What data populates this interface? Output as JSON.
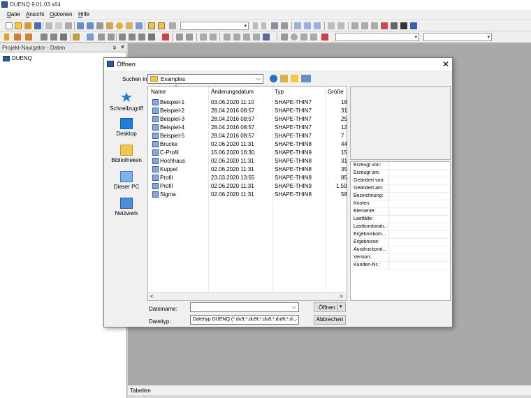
{
  "app": {
    "title": "DUENQ 9.01.03 x64"
  },
  "menu": {
    "items": [
      {
        "accel": "D",
        "rest": "atei"
      },
      {
        "accel": "A",
        "rest": "nsicht"
      },
      {
        "accel": "O",
        "rest": "ptionen"
      },
      {
        "accel": "H",
        "rest": "ilfe"
      }
    ]
  },
  "navigator": {
    "title": "Projekt-Navigator - Daten",
    "pin": "ș",
    "close": "✕",
    "root": "DUENQ"
  },
  "tables_panel": {
    "title": "Tabellen"
  },
  "dialog": {
    "title": "Öffnen",
    "close": "✕",
    "look_in_label": "Suchen in:",
    "look_in_value": "Examples",
    "places": [
      "Schnellzugriff",
      "Desktop",
      "Bibliotheken",
      "Dieser PC",
      "Netzwerk"
    ],
    "columns": [
      "Name",
      "Änderungsdatum",
      "Typ",
      "Größe"
    ],
    "files": [
      {
        "name": "Beispiel-1",
        "date": "03.06.2020 11:10",
        "type": "SHAPE-THIN7",
        "size": "18"
      },
      {
        "name": "Beispiel-2",
        "date": "28.04.2016 08:57",
        "type": "SHAPE-THIN7",
        "size": "31"
      },
      {
        "name": "Beispiel-3",
        "date": "28.04.2016 08:57",
        "type": "SHAPE-THIN7",
        "size": "25"
      },
      {
        "name": "Beispiel-4",
        "date": "28.04.2016 08:57",
        "type": "SHAPE-THIN7",
        "size": "12"
      },
      {
        "name": "Beispiel-5",
        "date": "28.04.2016 08:57",
        "type": "SHAPE-THIN7",
        "size": "7"
      },
      {
        "name": "Brucke",
        "date": "02.06.2020 11:31",
        "type": "SHAPE-THIN8",
        "size": "44"
      },
      {
        "name": "C-Profil",
        "date": "15.06.2020 16:30",
        "type": "SHAPE-THIN9",
        "size": "15"
      },
      {
        "name": "Hochhaus",
        "date": "02.06.2020 11:31",
        "type": "SHAPE-THIN8",
        "size": "31"
      },
      {
        "name": "Kuppel",
        "date": "02.06.2020 11:31",
        "type": "SHAPE-THIN8",
        "size": "35"
      },
      {
        "name": "Profil",
        "date": "23.03.2020 13:55",
        "type": "SHAPE-THIN8",
        "size": "85"
      },
      {
        "name": "Profil",
        "date": "02.06.2020 11:31",
        "type": "SHAPE-THIN9",
        "size": "1.59"
      },
      {
        "name": "Sigma",
        "date": "02.06.2020 11:31",
        "type": "SHAPE-THIN8",
        "size": "58"
      }
    ],
    "properties": [
      "Erzeugt von:",
      "Erzeugt am:",
      "Geändert von:",
      "Geändert am:",
      "Bezeichnung:",
      "Knoten:",
      "Elemente:",
      "Lastfälle:",
      "Lastkombinati...",
      "Ergebniskom...",
      "Ergebnisse:",
      "Ausdruckprot...",
      "Version:",
      "Kunden-Nr.:"
    ],
    "filename_label": "Dateiname:",
    "filename_value": "",
    "filetype_label": "Dateityp:",
    "filetype_value": "Dateityp DUENQ (*.du9;*.du9t;*.du8;*.du8t;*.du",
    "open_button": "Öffnen",
    "cancel_button": "Abbrechen"
  }
}
